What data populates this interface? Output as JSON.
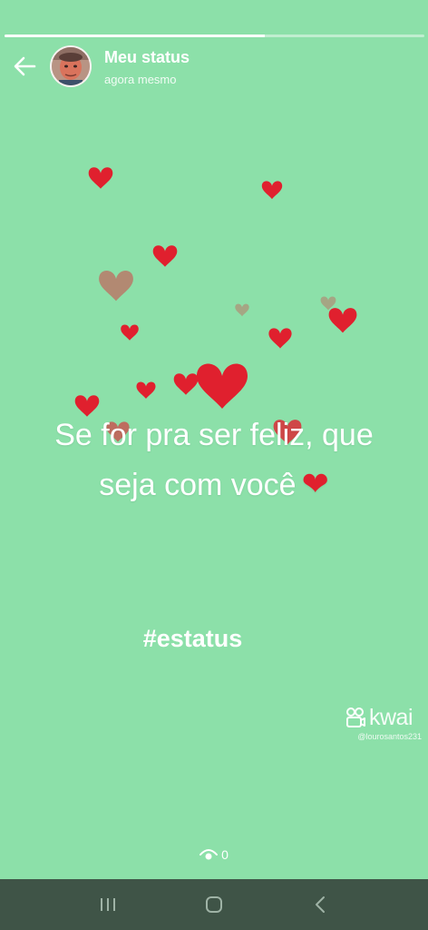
{
  "progress": {
    "fraction": 0.62
  },
  "header": {
    "title": "Meu status",
    "time": "agora mesmo",
    "back_icon": "arrow-left-icon",
    "avatar": "profile-photo"
  },
  "status": {
    "background_color": "#8ce0a9",
    "caption_line1": "Se for pra ser feliz, que",
    "caption_line2": "seja com você",
    "caption_emoji": "❤",
    "hashtag": "#estatus",
    "watermark_brand": "kwai",
    "watermark_handle": "@lourosantos231",
    "heart_color": "#e0202e"
  },
  "footer": {
    "views_icon": "eye-icon",
    "views_count": "0"
  },
  "navbar": {
    "recents_icon": "recents-icon",
    "home_icon": "home-icon",
    "back_icon": "chevron-left-icon"
  }
}
